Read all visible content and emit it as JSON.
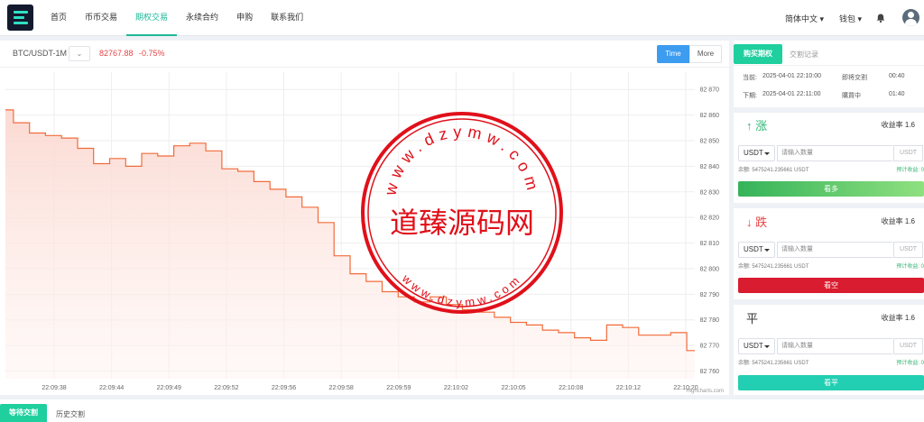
{
  "nav": {
    "items": [
      "首页",
      "币币交易",
      "期权交易",
      "永续合约",
      "申购",
      "联系我们"
    ],
    "active": 2,
    "language": "简体中文",
    "wallet": "钱包"
  },
  "header": {
    "symbol": "BTC/USDT-1M",
    "price": "82767.88",
    "change": "-0.75%",
    "btn_time": "Time",
    "btn_more": "More"
  },
  "chart_data": {
    "type": "area",
    "x_labels": [
      "22:09:38",
      "22:09:44",
      "22:09:49",
      "22:09:52",
      "22:09:56",
      "22:09:58",
      "22:09:59",
      "22:10:02",
      "22:10:05",
      "22:10:08",
      "22:10:12",
      "22:10:20"
    ],
    "y_ticks": [
      82870,
      82860,
      82850,
      82840,
      82830,
      82820,
      82810,
      82800,
      82790,
      82780,
      82770,
      82760
    ],
    "y_tick_labels": [
      "82 870",
      "82 860",
      "82 850",
      "82 840",
      "82 830",
      "82 820",
      "82 810",
      "82 800",
      "82 790",
      "82 780",
      "82 770",
      "82 760"
    ],
    "ylim": [
      82757,
      82875
    ],
    "credit": "Highcharts.com",
    "line_color": "#f26b3a",
    "values": [
      82862,
      82857,
      82853,
      82852,
      82851,
      82847,
      82841,
      82843,
      82840,
      82845,
      82844,
      82848,
      82849,
      82846,
      82839,
      82838,
      82834,
      82831,
      82828,
      82824,
      82818,
      82805,
      82798,
      82795,
      82791,
      82789,
      82787,
      82789,
      82786,
      82784,
      82783,
      82781,
      82779,
      82778,
      82776,
      82775,
      82773,
      82772,
      82778,
      82777,
      82774,
      82774,
      82775,
      82768
    ]
  },
  "side": {
    "tab_buy": "购买期权",
    "tab_records": "交割记录",
    "current_label": "当前:",
    "current_time": "2025-04-01 22:10:00",
    "current_status": "即将交割",
    "current_count": "00:40",
    "next_label": "下期:",
    "next_time": "2025-04-01 22:11:00",
    "next_status": "購買中",
    "next_count": "01:40",
    "up": {
      "title": "↑ 涨",
      "rate": "收益率 1.6",
      "currency": "USDT",
      "placeholder": "请输入数量",
      "unit": "USDT",
      "balance": "余额: 5475241.235661 USDT",
      "expected": "预计收益: 0",
      "button": "看多"
    },
    "down": {
      "title": "↓ 跌",
      "rate": "收益率 1.6",
      "currency": "USDT",
      "placeholder": "请输入数量",
      "unit": "USDT",
      "balance": "余额: 5475241.235661 USDT",
      "expected": "预计收益: 0",
      "button": "看空"
    },
    "flat": {
      "title": "平",
      "rate": "收益率 1.6",
      "currency": "USDT",
      "placeholder": "请输入数量",
      "unit": "USDT",
      "balance": "余额: 5475241.235661 USDT",
      "expected": "预计收益: 0",
      "button": "看平"
    }
  },
  "bottom": {
    "tab_wait": "等待交割",
    "tab_history": "历史交割"
  },
  "stamp": {
    "main": "道臻源码网",
    "ring_top": "www.dzymw.com",
    "ring_bottom": "www.dzymw.com",
    "color": "#e0101a"
  }
}
